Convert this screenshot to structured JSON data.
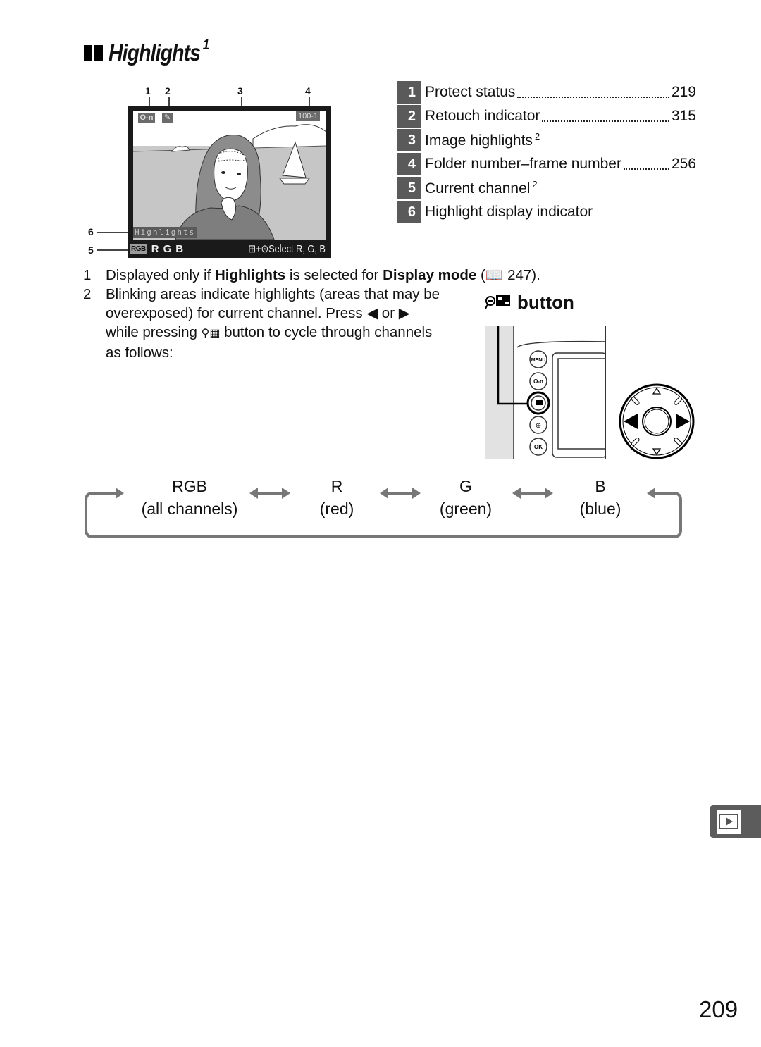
{
  "title": {
    "text": "Highlights",
    "footnote_ref": "1"
  },
  "screen": {
    "callouts": [
      "1",
      "2",
      "3",
      "4",
      "5",
      "6"
    ],
    "folder_frame": "100-1",
    "highlights_label": "Highlights",
    "channel_chip": "RGB",
    "channels": [
      "R",
      "G",
      "B"
    ],
    "select_hint": "⊞+⊙Select R, G, B"
  },
  "legend": [
    {
      "num": "1",
      "label": "Protect status",
      "sup": "",
      "page": "219"
    },
    {
      "num": "2",
      "label": "Retouch indicator",
      "sup": "",
      "page": "315"
    },
    {
      "num": "3",
      "label": "Image highlights",
      "sup": "2",
      "page": ""
    },
    {
      "num": "4",
      "label": "Folder number–frame number",
      "sup": "",
      "page": "256"
    },
    {
      "num": "5",
      "label": "Current channel",
      "sup": "2",
      "page": ""
    },
    {
      "num": "6",
      "label": "Highlight display indicator",
      "sup": "",
      "page": ""
    }
  ],
  "notes": {
    "n1": "1",
    "n1_pre": "Displayed only if ",
    "n1_b1": "Highlights",
    "n1_mid": " is selected for ",
    "n1_b2": "Display mode",
    "n1_post": " (📖 247).",
    "n2": "2",
    "n2_line1": "Blinking areas indicate highlights (areas that may be",
    "n2_line2a": "overexposed) for current channel.  Press ",
    "n2_left": "◀",
    "n2_or": " or ",
    "n2_right": "▶",
    "n2_line3a": "while pressing ",
    "n2_line3b": " button to cycle through channels",
    "n2_line4": "as follows:"
  },
  "button_heading": "button",
  "camera_buttons": [
    "MENU",
    "O-n",
    "OK"
  ],
  "cycle": [
    {
      "code": "RGB",
      "desc": "(all channels)"
    },
    {
      "code": "R",
      "desc": "(red)"
    },
    {
      "code": "G",
      "desc": "(green)"
    },
    {
      "code": "B",
      "desc": "(blue)"
    }
  ],
  "side_tab": {
    "icon": "playback-icon"
  },
  "page_number": "209",
  "colors": {
    "tab_gray": "#5c5c5c",
    "arrow_gray": "#777777",
    "screen_bg": "#1a1a1a"
  }
}
